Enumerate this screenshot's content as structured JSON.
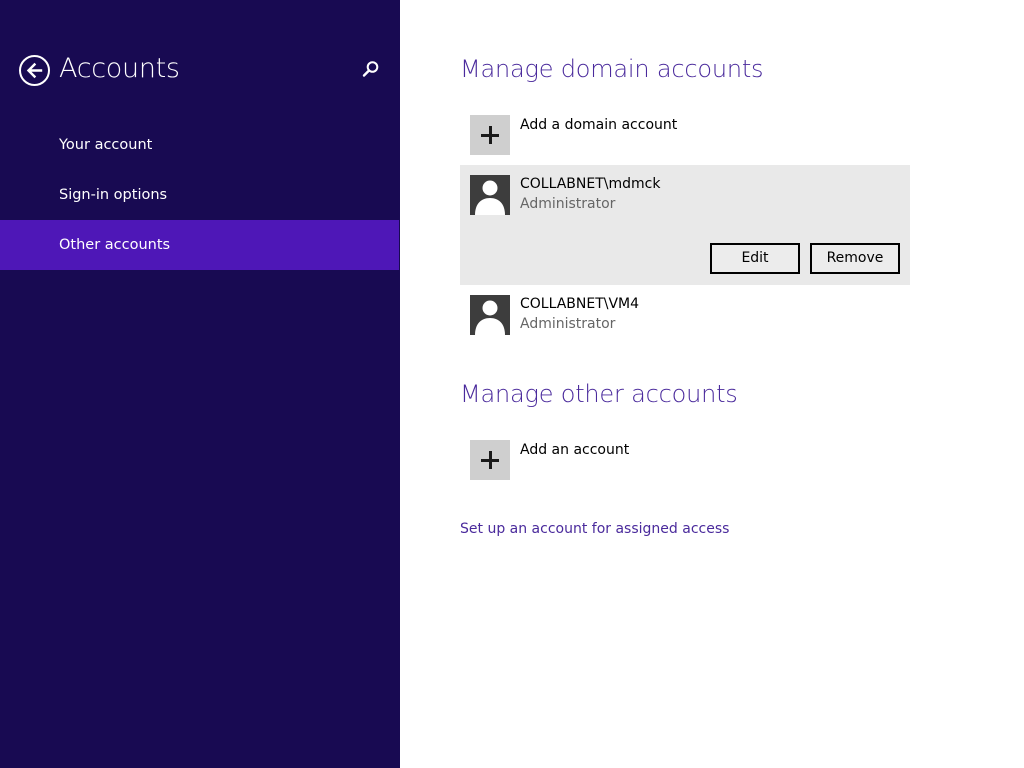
{
  "sidebar": {
    "title": "Accounts",
    "back_icon": "back-arrow-icon",
    "search_icon": "search-icon",
    "items": [
      {
        "label": "Your account",
        "selected": false
      },
      {
        "label": "Sign-in options",
        "selected": false
      },
      {
        "label": "Other accounts",
        "selected": true
      }
    ]
  },
  "domain_section": {
    "title": "Manage domain accounts",
    "add_label": "Add a domain account",
    "accounts": [
      {
        "name": "COLLABNET\\mdmck",
        "role": "Administrator",
        "selected": true
      },
      {
        "name": "COLLABNET\\VM4",
        "role": "Administrator",
        "selected": false
      }
    ],
    "edit_label": "Edit",
    "remove_label": "Remove"
  },
  "other_section": {
    "title": "Manage other accounts",
    "add_label": "Add an account"
  },
  "assigned_access_link": "Set up an account for assigned access",
  "colors": {
    "sidebar_bg": "#180a52",
    "selected_nav": "#4e17b7",
    "accent_text": "#4a2a9c",
    "selected_account_bg": "#e9e9e9"
  }
}
